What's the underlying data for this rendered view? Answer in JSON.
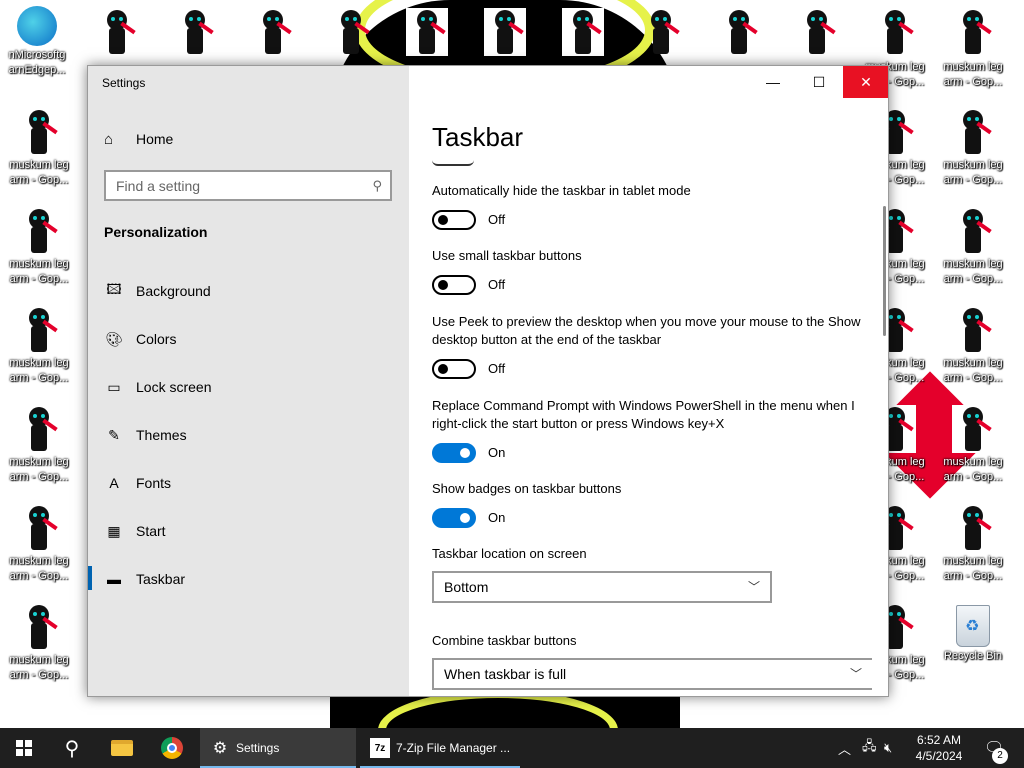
{
  "desktop": {
    "icons": [
      {
        "label": "nMicrosoftg arnEdgep..."
      },
      {
        "label": "muskum leg arm - Gop..."
      },
      {
        "label": "Recycle Bin"
      }
    ]
  },
  "window": {
    "title": "Settings",
    "controls": {
      "minimize": "—",
      "maximize": "☐",
      "close": "✕"
    }
  },
  "sidebar": {
    "home_label": "Home",
    "search_placeholder": "Find a setting",
    "section_title": "Personalization",
    "items": [
      {
        "label": "Background",
        "icon": "image-icon"
      },
      {
        "label": "Colors",
        "icon": "palette-icon"
      },
      {
        "label": "Lock screen",
        "icon": "lock-screen-icon"
      },
      {
        "label": "Themes",
        "icon": "themes-icon"
      },
      {
        "label": "Fonts",
        "icon": "fonts-icon"
      },
      {
        "label": "Start",
        "icon": "start-icon"
      },
      {
        "label": "Taskbar",
        "icon": "taskbar-icon"
      }
    ]
  },
  "main": {
    "page_title": "Taskbar",
    "settings": [
      {
        "label": "Automatically hide the taskbar in tablet mode",
        "state": "Off"
      },
      {
        "label": "Use small taskbar buttons",
        "state": "Off"
      },
      {
        "label": "Use Peek to preview the desktop when you move your mouse to the Show desktop button at the end of the taskbar",
        "state": "Off"
      },
      {
        "label": "Replace Command Prompt with Windows PowerShell in the menu when I right-click the start button or press Windows key+X",
        "state": "On"
      },
      {
        "label": "Show badges on taskbar buttons",
        "state": "On"
      }
    ],
    "location": {
      "label": "Taskbar location on screen",
      "value": "Bottom"
    },
    "combine": {
      "label": "Combine taskbar buttons",
      "value": "When taskbar is full"
    }
  },
  "taskbar": {
    "apps": [
      {
        "label": "Settings"
      },
      {
        "label": "7-Zip File Manager ..."
      }
    ],
    "clock": {
      "time": "6:52 AM",
      "date": "4/5/2024"
    },
    "notification_count": "2"
  },
  "colors": {
    "accent": "#0078d7",
    "close_button": "#e81123",
    "taskbar": "#1f1f1f",
    "sidebar": "#e6e6e6"
  }
}
